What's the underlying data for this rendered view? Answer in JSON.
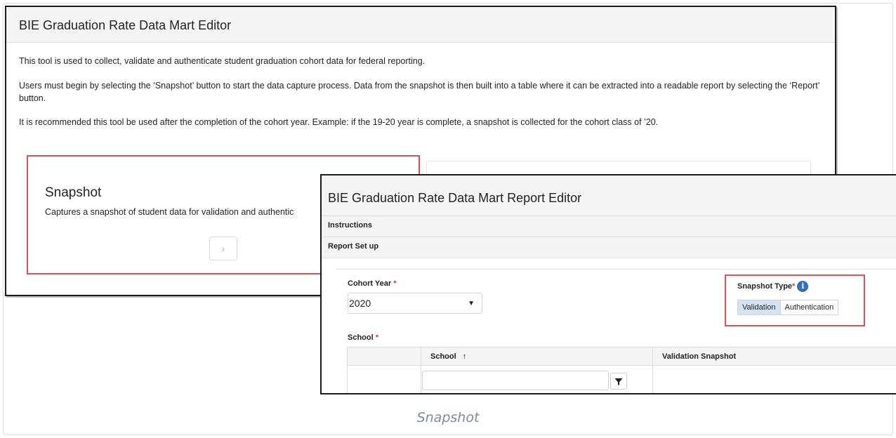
{
  "main": {
    "title": "BIE Graduation Rate Data Mart Editor",
    "paragraphs": [
      "This tool is used to collect, validate and authenticate student graduation cohort data for federal reporting.",
      "Users must begin by selecting the ‘Snapshot’ button to start the data capture process. Data from the snapshot is then built into a table where it can be extracted into a readable report by selecting the ‘Report’ button.",
      "It is recommended this tool be used after the completion of the cohort year. Example: if the 19-20 year is complete, a snapshot is collected for the cohort class of ’20."
    ],
    "snapshot_card": {
      "title": "Snapshot",
      "description": "Captures a snapshot of student data for validation and authentic",
      "button_glyph": "›"
    }
  },
  "report": {
    "title": "BIE Graduation Rate Data Mart Report Editor",
    "sections": [
      "Instructions",
      "Report Set up"
    ],
    "cohort_year": {
      "label": "Cohort Year",
      "required_mark": "*",
      "value": "2020"
    },
    "snapshot_type": {
      "label": "Snapshot Type",
      "required_mark": "*",
      "info_glyph": "i",
      "options": [
        "Validation",
        "Authentication"
      ],
      "selected": "Validation"
    },
    "school": {
      "label": "School",
      "required_mark": "*",
      "columns": [
        "School",
        "Validation Snapshot"
      ],
      "sort_glyph": "↑"
    }
  },
  "caption": "Snapshot",
  "colors": {
    "highlight": "#e05252",
    "info_blue": "#2f6fbd",
    "toggle_active": "#d3e3f3",
    "caption": "#7a8ba0"
  }
}
